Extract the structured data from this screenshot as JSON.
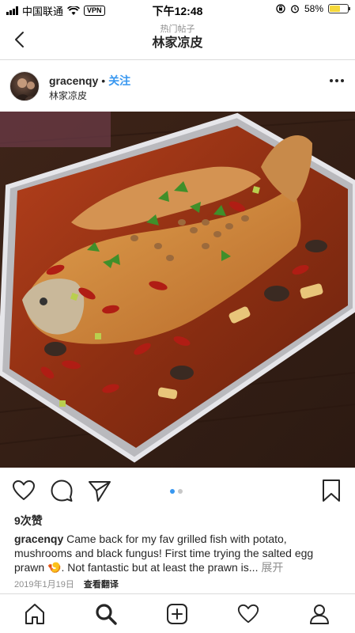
{
  "status_bar": {
    "carrier": "中国联通",
    "vpn": "VPN",
    "time": "下午12:48",
    "battery": "58%",
    "battery_level": 0.58
  },
  "header": {
    "subtitle": "热门帖子",
    "title": "林家凉皮"
  },
  "post": {
    "username": "gracenqy",
    "separator": "•",
    "follow_label": "关注",
    "location": "林家凉皮",
    "likes": "9次赞",
    "caption_user": "gracenqy",
    "caption_text": " Came back for my fav grilled fish with potato, mushrooms and black fungus! First time trying the salted egg prawn 🍤. Not fantastic but at least the prawn is...",
    "more_label": "展开",
    "date": "2019年1月19日",
    "translate_label": "查看翻译"
  },
  "carousel": {
    "count": 2,
    "active": 0
  },
  "icons": {
    "back": "chevron-left-icon",
    "more": "more-horizontal-icon",
    "like": "heart-icon",
    "comment": "comment-icon",
    "share": "send-icon",
    "save": "bookmark-icon",
    "home": "home-icon",
    "search": "search-icon",
    "new_post": "plus-square-icon",
    "activity": "heart-icon",
    "profile": "user-icon"
  },
  "colors": {
    "link": "#3897f0",
    "muted": "#8e8e8e",
    "text": "#262626",
    "divider": "#dbdbdb"
  }
}
